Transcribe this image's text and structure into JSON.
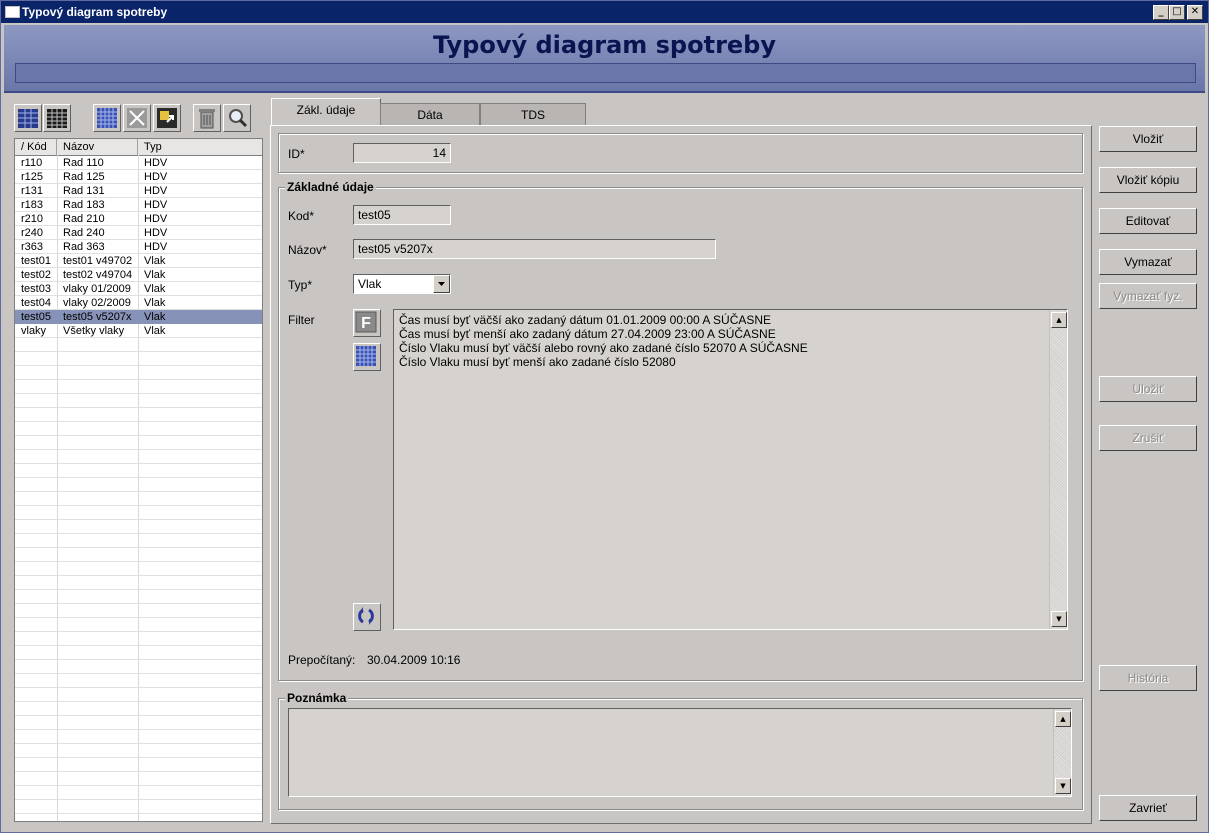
{
  "window": {
    "title": "Typový diagram spotreby",
    "minimize": "_",
    "maximize": "□",
    "close": "✕"
  },
  "header": {
    "title": "Typový diagram spotreby"
  },
  "grid": {
    "columns": [
      "/ Kód",
      "Názov",
      "Typ"
    ],
    "rows": [
      [
        "r110",
        "Rad 110",
        "HDV"
      ],
      [
        "r125",
        "Rad 125",
        "HDV"
      ],
      [
        "r131",
        "Rad 131",
        "HDV"
      ],
      [
        "r183",
        "Rad 183",
        "HDV"
      ],
      [
        "r210",
        "Rad 210",
        "HDV"
      ],
      [
        "r240",
        "Rad 240",
        "HDV"
      ],
      [
        "r363",
        "Rad 363",
        "HDV"
      ],
      [
        "test01",
        "test01 v49702",
        "Vlak"
      ],
      [
        "test02",
        "test02 v49704",
        "Vlak"
      ],
      [
        "test03",
        "vlaky 01/2009",
        "Vlak"
      ],
      [
        "test04",
        "vlaky 02/2009",
        "Vlak"
      ],
      [
        "test05",
        "test05 v5207x",
        "Vlak"
      ],
      [
        "vlaky",
        "Všetky vlaky",
        "Vlak"
      ]
    ],
    "selected_index": 11
  },
  "tabs": [
    {
      "label": "Zákl. údaje",
      "active": true
    },
    {
      "label": "Dáta",
      "active": false
    },
    {
      "label": "TDS",
      "active": false
    }
  ],
  "form": {
    "id_label": "ID*",
    "id_value": "14",
    "section_title": "Základné údaje",
    "kod_label": "Kod*",
    "kod_value": "test05",
    "nazov_label": "Názov*",
    "nazov_value": "test05 v5207x",
    "typ_label": "Typ*",
    "typ_value": "Vlak",
    "filter_label": "Filter",
    "filter_button_glyph": "F",
    "filter_lines": [
      "Čas musí byť väčší ako zadaný dátum 01.01.2009 00:00 A SÚČASNE",
      "Čas musí byť menší ako zadaný dátum 27.04.2009 23:00 A SÚČASNE",
      "Číslo Vlaku musí byť väčší alebo rovný ako zadané číslo 52070 A SÚČASNE",
      "Číslo Vlaku musí byť menší ako zadané číslo 52080"
    ],
    "prepocitany_label": "Prepočítaný:",
    "prepocitany_value": "30.04.2009 10:16",
    "poznamka_title": "Poznámka",
    "poznamka_value": ""
  },
  "actions": {
    "vlozit": "Vložiť",
    "vlozit_kopiu": "Vložiť kópiu",
    "editovat": "Editovať",
    "vymazat": "Vymazať",
    "vymazat_fyz": "Vymazať fyz.",
    "ulozit": "Uložiť",
    "zrusit": "Zrušiť",
    "historia": "História",
    "zavriet": "Zavrieť"
  },
  "colors": {
    "header_bg": "#7782b2",
    "title_text": "#0a1450",
    "selection": "#8792b8",
    "titlebar": "#0a246a"
  }
}
